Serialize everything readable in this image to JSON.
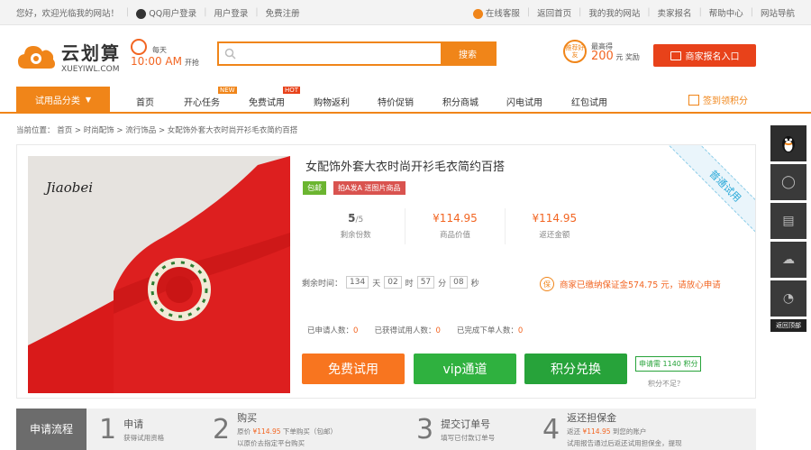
{
  "topbar": {
    "welcome": "您好，欢迎光临我的网站！",
    "qq_login": "QQ用户登录",
    "user_login": "用户登录",
    "register": "免费注册",
    "online_service": "在线客服",
    "back_home": "返回首页",
    "my_site": "我的我的网站",
    "merchant_apply": "卖家报名",
    "help": "帮助中心",
    "site_nav": "网站导航"
  },
  "header": {
    "logo_cn": "云划算",
    "logo_en": "XUEYIWL.COM",
    "clock_label": "每天",
    "clock_time": "10:00 AM",
    "clock_suffix": "开抢",
    "search_button": "搜索",
    "search_placeholder": "",
    "invite_badge": "推荐好友",
    "invite_top": "最高得",
    "invite_amount": "200",
    "invite_unit": "元 奖励",
    "merchant_entry": "商家报名入口"
  },
  "nav": {
    "category": "试用品分类",
    "items": [
      "首页",
      "开心任务",
      "免费试用",
      "购物返利",
      "特价促销",
      "积分商城",
      "闪电试用",
      "红包试用"
    ],
    "badge_new": "NEW",
    "badge_hot": "HOT",
    "sign_in": "签到领积分"
  },
  "breadcrumb": "当前位置： 首页 > 时尚配饰 > 流行饰品 > 女配饰外套大衣时尚开衫毛衣简约百搭",
  "product": {
    "photo_brand": "Jiaobei",
    "title": "女配饰外套大衣时尚开衫毛衣简约百搭",
    "tag_shipping": "包邮",
    "tag_type": "拍A发A 送图片商品",
    "stat_remaining": "5",
    "stat_remaining_total": "/5",
    "stat_remaining_label": "剩余份数",
    "stat_price": "¥114.95",
    "stat_price_label": "商品价值",
    "stat_refund": "¥114.95",
    "stat_refund_label": "返还金额",
    "ribbon": "普通试用",
    "time_label": "剩余时间：",
    "days": "134",
    "days_unit": "天",
    "hours": "02",
    "hours_unit": "时",
    "minutes": "57",
    "minutes_unit": "分",
    "seconds": "08",
    "seconds_unit": "秒",
    "guarantee_icon": "保",
    "guarantee_text": "商家已缴纳保证金574.75 元，请放心申请",
    "applied_label": "已申请人数：",
    "applied_val": "0",
    "got_label": "已获得试用人数：",
    "got_val": "0",
    "done_label": "已完成下单人数：",
    "done_val": "0",
    "btn_free": "免费试用",
    "btn_vip": "vip通道",
    "btn_points": "积分兑换",
    "need_points": "申请需 1140 积分",
    "points_low": "积分不足？"
  },
  "sidebar": {
    "back_top": "返回顶部"
  },
  "flow": {
    "head": "申请流程",
    "steps": [
      {
        "num": "1",
        "title": "申请",
        "desc": "获得试用资格"
      },
      {
        "num": "2",
        "title": "购买",
        "desc_pre": "原价 ",
        "desc_price": "¥114.95",
        "desc_post": " 下单购买（包邮）",
        "desc2": "以原价去指定平台购买"
      },
      {
        "num": "3",
        "title": "提交订单号",
        "desc": "填写已付款订单号"
      },
      {
        "num": "4",
        "title": "返还担保金",
        "desc_pre": "返还 ",
        "desc_price": "¥114.95",
        "desc_post": " 到您的账户",
        "desc2": "试用报告通过后返还试用担保金，提现"
      }
    ]
  },
  "colors": {
    "accent": "#f08519",
    "price": "#f26522",
    "btn_free": "#f8751f",
    "btn_vip": "#2fb13f",
    "btn_points": "#27a33a",
    "tag_shipping": "#6bb530",
    "tag_type": "#d9534f"
  }
}
